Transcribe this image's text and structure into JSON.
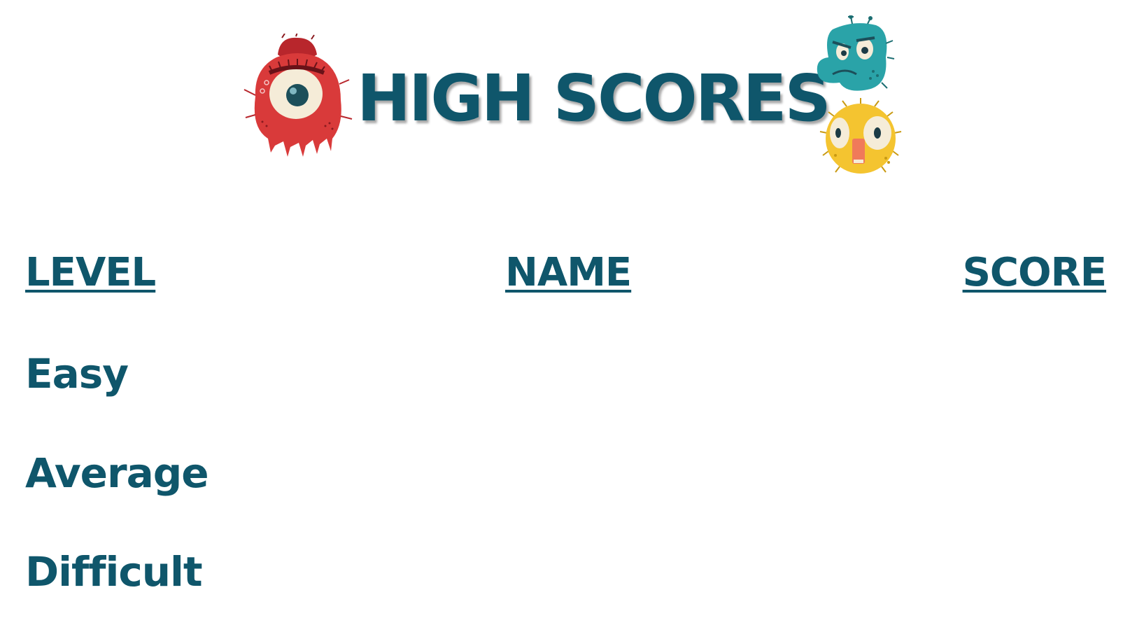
{
  "header": {
    "title": "HIGH SCORES"
  },
  "colors": {
    "primary": "#0f566b",
    "monster_red": "#d93a3a",
    "monster_teal": "#2aa3a8",
    "monster_yellow": "#f4c430"
  },
  "icons": {
    "left": "red-one-eyed-monster-icon",
    "top_right": "teal-grumpy-monster-icon",
    "bottom_right": "yellow-spiky-monster-icon"
  },
  "table": {
    "columns": {
      "level": "LEVEL",
      "name": "NAME",
      "score": "SCORE"
    },
    "rows": [
      {
        "level": "Easy",
        "name": "",
        "score": ""
      },
      {
        "level": "Average",
        "name": "",
        "score": ""
      },
      {
        "level": "Difficult",
        "name": "",
        "score": ""
      }
    ]
  }
}
